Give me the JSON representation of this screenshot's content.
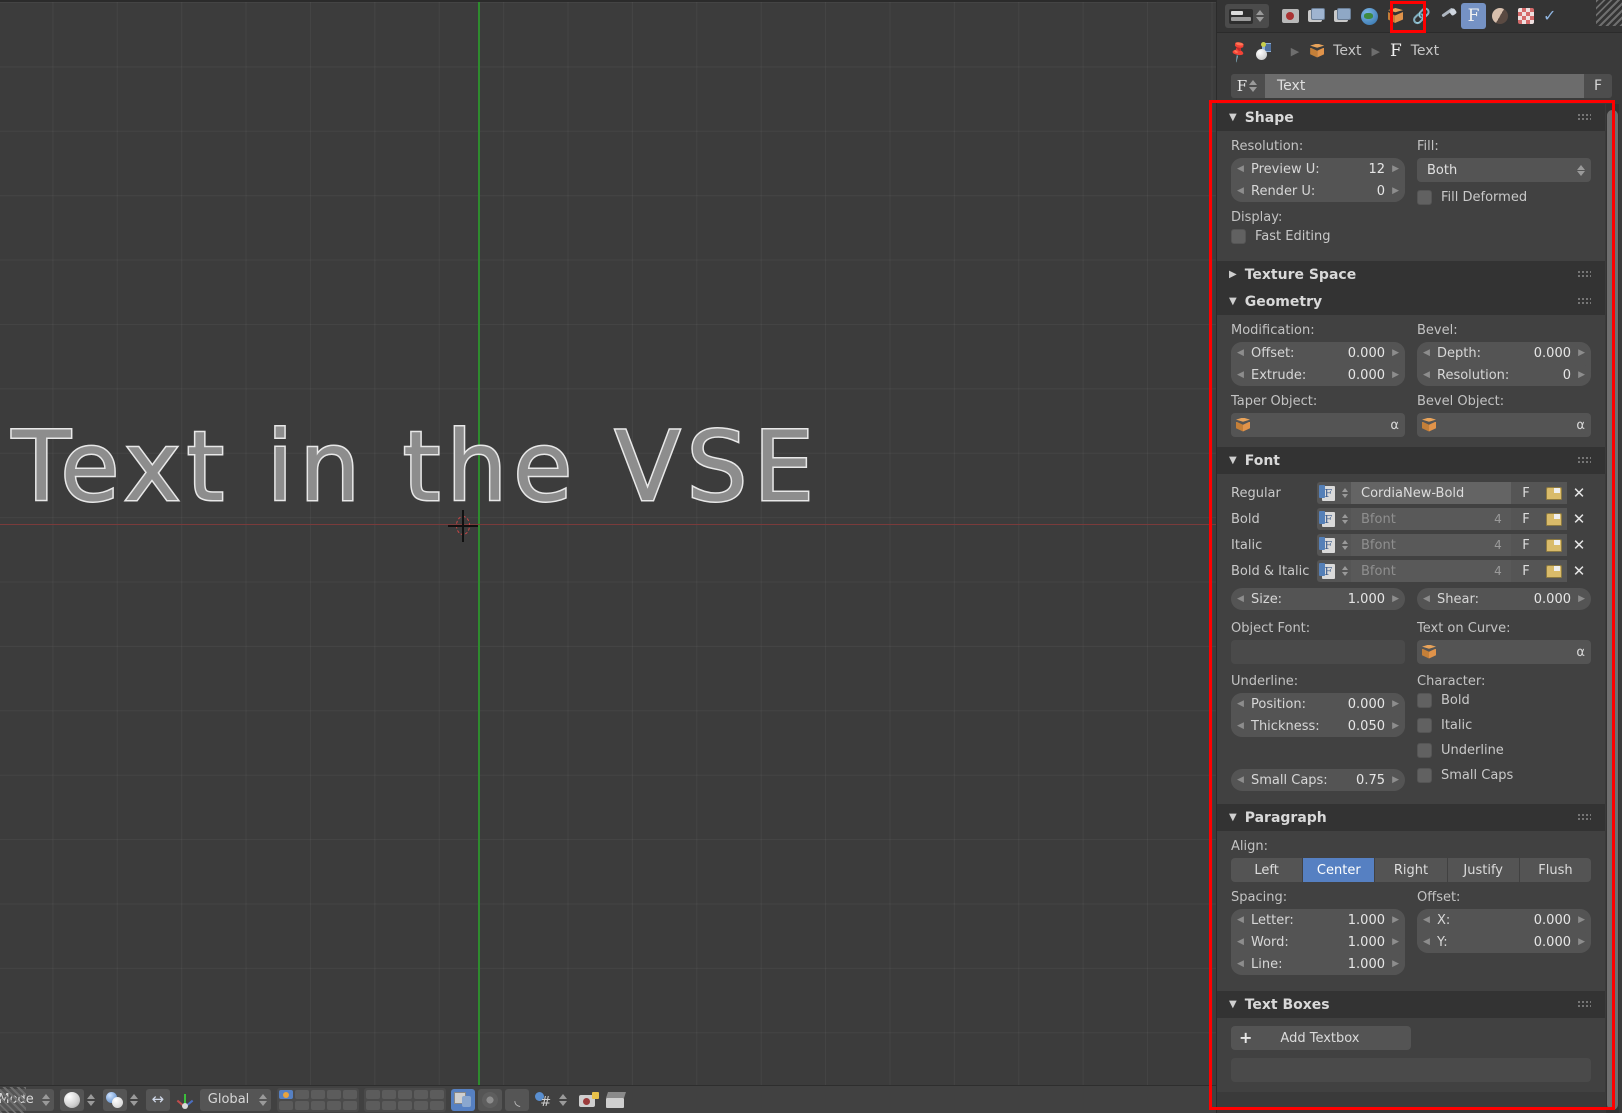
{
  "viewport": {
    "text_object_content": "Text in the VSE",
    "grid_color": "#4a4a4a",
    "y_axis_color": "#2e8b2e",
    "x_axis_color": "#7a3b3b",
    "header": {
      "mode_label": "ect Mode",
      "transform_orientation": "Global",
      "icons": [
        "object-mode-dropdown",
        "viewport-shading-solid",
        "viewport-shading-texture",
        "manipulator-toggle",
        "transform-orientation-axis",
        "scene-layers",
        "layer-grid-2",
        "copy-link-icon",
        "snap-target-icon",
        "snap-magnet-icon",
        "proportional-edit-icon",
        "render-camera-icon",
        "clapperboard-icon"
      ]
    }
  },
  "properties": {
    "header": {
      "nav_label": "properties-nav",
      "tabs": [
        {
          "name": "render",
          "selected": false
        },
        {
          "name": "scene-render-layers",
          "selected": false
        },
        {
          "name": "scene",
          "selected": false
        },
        {
          "name": "world",
          "selected": false
        },
        {
          "name": "object",
          "selected": false
        },
        {
          "name": "constraints",
          "selected": false
        },
        {
          "name": "modifiers",
          "selected": false
        },
        {
          "name": "object-data-font",
          "selected": true
        },
        {
          "name": "material",
          "selected": false
        },
        {
          "name": "texture",
          "selected": false
        },
        {
          "name": "particles",
          "selected": false
        }
      ]
    },
    "breadcrumb": {
      "pin": "pin-icon",
      "editor_icon": "editor-type-icon",
      "items": [
        {
          "icon": "object-cube-icon",
          "label": "Text"
        },
        {
          "icon": "font-F-icon",
          "label": "Text"
        }
      ]
    },
    "name_field": {
      "prefix_icon": "font-datablock-icon",
      "value": "Text",
      "fake_user_label": "F"
    },
    "panels": {
      "shape": {
        "title": "Shape",
        "open": true,
        "resolution_label": "Resolution:",
        "preview_u": {
          "label": "Preview U:",
          "value": "12"
        },
        "render_u": {
          "label": "Render U:",
          "value": "0"
        },
        "fill_label": "Fill:",
        "fill_value": "Both",
        "fill_deformed": {
          "label": "Fill Deformed",
          "checked": false
        },
        "display_label": "Display:",
        "fast_editing": {
          "label": "Fast Editing",
          "checked": false
        }
      },
      "texture_space": {
        "title": "Texture Space",
        "open": false
      },
      "geometry": {
        "title": "Geometry",
        "open": true,
        "modification_label": "Modification:",
        "offset": {
          "label": "Offset:",
          "value": "0.000"
        },
        "extrude": {
          "label": "Extrude:",
          "value": "0.000"
        },
        "bevel_label": "Bevel:",
        "depth": {
          "label": "Depth:",
          "value": "0.000"
        },
        "bevel_resolution": {
          "label": "Resolution:",
          "value": "0"
        },
        "taper_object_label": "Taper Object:",
        "bevel_object_label": "Bevel Object:"
      },
      "font": {
        "title": "Font",
        "open": true,
        "rows": [
          {
            "label": "Regular",
            "value": "CordiaNew-Bold",
            "placeholder": false,
            "users": "",
            "f_label": "F"
          },
          {
            "label": "Bold",
            "value": "Bfont",
            "placeholder": true,
            "users": "4",
            "f_label": "F"
          },
          {
            "label": "Italic",
            "value": "Bfont",
            "placeholder": true,
            "users": "4",
            "f_label": "F"
          },
          {
            "label": "Bold & Italic",
            "value": "Bfont",
            "placeholder": true,
            "users": "4",
            "f_label": "F"
          }
        ],
        "size": {
          "label": "Size:",
          "value": "1.000"
        },
        "shear": {
          "label": "Shear:",
          "value": "0.000"
        },
        "object_font_label": "Object Font:",
        "text_on_curve_label": "Text on Curve:",
        "underline_label": "Underline:",
        "position": {
          "label": "Position:",
          "value": "0.000"
        },
        "thickness": {
          "label": "Thickness:",
          "value": "0.050"
        },
        "small_caps_scale": {
          "label": "Small Caps:",
          "value": "0.75"
        },
        "character_label": "Character:",
        "character_bold": {
          "label": "Bold",
          "checked": false
        },
        "character_italic": {
          "label": "Italic",
          "checked": false
        },
        "character_underline": {
          "label": "Underline",
          "checked": false
        },
        "character_small_caps": {
          "label": "Small Caps",
          "checked": false
        }
      },
      "paragraph": {
        "title": "Paragraph",
        "open": true,
        "align_label": "Align:",
        "align_options": [
          "Left",
          "Center",
          "Right",
          "Justify",
          "Flush"
        ],
        "align_selected": "Center",
        "spacing_label": "Spacing:",
        "letter": {
          "label": "Letter:",
          "value": "1.000"
        },
        "word": {
          "label": "Word:",
          "value": "1.000"
        },
        "line": {
          "label": "Line:",
          "value": "1.000"
        },
        "offset_label": "Offset:",
        "offset_x": {
          "label": "X:",
          "value": "0.000"
        },
        "offset_y": {
          "label": "Y:",
          "value": "0.000"
        }
      },
      "text_boxes": {
        "title": "Text Boxes",
        "open": true,
        "add_textbox_label": "Add Textbox"
      }
    }
  },
  "annotations": {
    "highlight_color": "#ff0000",
    "boxes": [
      "font-data-tab-highlight",
      "font-properties-panel-highlight"
    ]
  }
}
